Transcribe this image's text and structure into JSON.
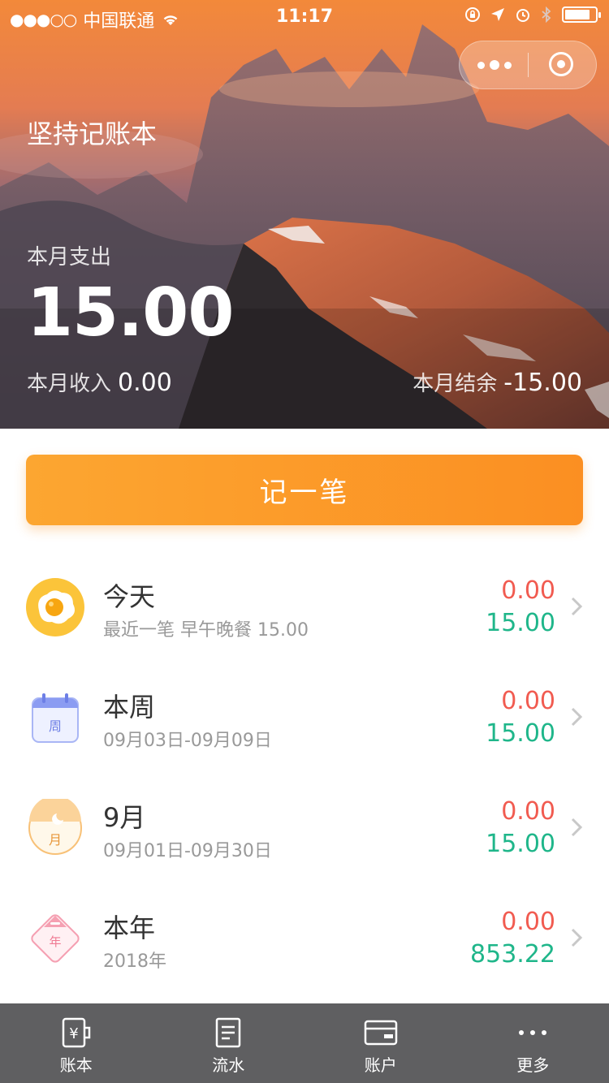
{
  "status_bar": {
    "signal": "●●●○○",
    "carrier": "中国联通",
    "time": "11:17"
  },
  "header": {
    "app_title": "坚持记账本",
    "month_expense_label": "本月支出",
    "month_expense_value": "15.00",
    "month_income_label": "本月收入",
    "month_income_value": "0.00",
    "month_balance_label": "本月结余",
    "month_balance_value": "-15.00"
  },
  "record_button_label": "记一笔",
  "summary_rows": [
    {
      "title": "今天",
      "subtitle": "最近一笔 早午晚餐 15.00",
      "income": "0.00",
      "expense": "15.00",
      "icon": "fried-egg-icon"
    },
    {
      "title": "本周",
      "subtitle": "09月03日-09月09日",
      "income": "0.00",
      "expense": "15.00",
      "icon": "calendar-week-icon",
      "icon_text": "周"
    },
    {
      "title": "9月",
      "subtitle": "09月01日-09月30日",
      "income": "0.00",
      "expense": "15.00",
      "icon": "calendar-month-icon",
      "icon_text": "月"
    },
    {
      "title": "本年",
      "subtitle": "2018年",
      "income": "0.00",
      "expense": "853.22",
      "icon": "calendar-year-icon",
      "icon_text": "年"
    }
  ],
  "colors": {
    "accent": "#fb9a2a",
    "income": "#f15b50",
    "expense": "#1fb68a",
    "tabbar": "#5f5f61"
  },
  "tabbar": [
    {
      "label": "账本",
      "icon": "ledger-icon"
    },
    {
      "label": "流水",
      "icon": "list-icon"
    },
    {
      "label": "账户",
      "icon": "card-icon"
    },
    {
      "label": "更多",
      "icon": "more-dots-icon"
    }
  ]
}
